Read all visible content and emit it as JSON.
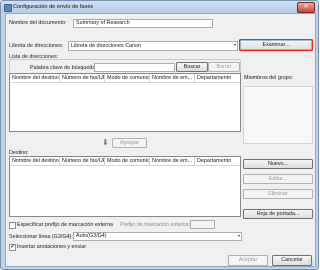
{
  "window": {
    "title": "Configuración de envío de faxes",
    "close_glyph": "✕"
  },
  "document_name": {
    "label": "Nombre del documento:",
    "value": "Summary of Research"
  },
  "address_book": {
    "label": "Libreta de direcciones:",
    "selected": "Libreta de direcciones Canon",
    "browse_label": "Examinar..."
  },
  "address_list": {
    "label": "Lista de direcciones:",
    "search_label": "Palabra clave de búsqueda:",
    "search_value": "",
    "search_button": "Buscar",
    "clear_button": "Borrar",
    "columns": [
      "Nombre del destino",
      "Número de fax/URI",
      "Modo de comunic...",
      "Nombre de em...",
      "Departamento"
    ],
    "members_label": "Miembros del grupo:"
  },
  "add_button": {
    "arrow": "⬇",
    "label": "Agregar"
  },
  "destination": {
    "label": "Destino:",
    "columns": [
      "Nombre del destino",
      "Número de fax/URI",
      "Modo de comunic...",
      "Nombre de em...",
      "Departamento"
    ],
    "new_button": "Nuevo...",
    "edit_button": "Editar...",
    "delete_button": "Eliminar",
    "cover_button": "Hoja de portada..."
  },
  "prefix": {
    "checkbox_label": "Especificar prefijo de marcación externa",
    "checked": false,
    "prefix_label": "Prefijo de marcación externa:",
    "prefix_value": ""
  },
  "line": {
    "label": "Seleccionar línea (G3/G4):",
    "selected": "Auto(G3/G4)"
  },
  "annotations": {
    "label": "Insertar anotaciones y enviar",
    "checked": true,
    "check_glyph": "✔"
  },
  "footer": {
    "accept_button": "Aceptar",
    "cancel_button": "Cancelar"
  }
}
